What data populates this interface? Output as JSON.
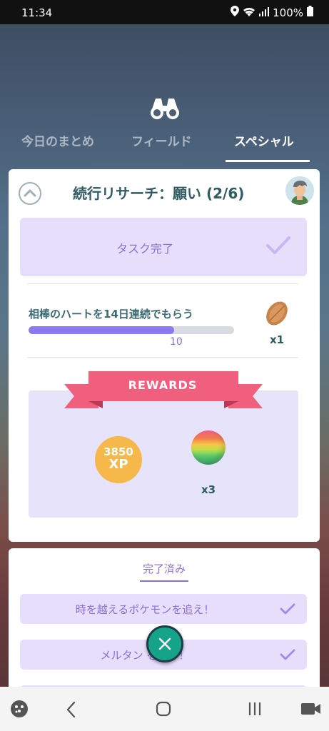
{
  "status_bar": {
    "time": "11:34",
    "battery": "100%"
  },
  "tabs": [
    {
      "label": "今日のまとめ",
      "active": false
    },
    {
      "label": "フィールド",
      "active": false
    },
    {
      "label": "スペシャル",
      "active": true
    }
  ],
  "research": {
    "title": "続行リサーチ：願い (2/6)",
    "task_done_label": "タスク完了",
    "task": {
      "text": "相棒のハートを14日連続でもらう",
      "progress_value": "10",
      "progress_fraction": 0.71,
      "reward_qty": "x1"
    },
    "rewards": {
      "banner": "REWARDS",
      "xp_amount": "3850",
      "xp_unit": "XP",
      "item_qty": "x3"
    }
  },
  "completed": {
    "title": "完了済み",
    "items": [
      {
        "label": "時を越えるポケモンを追え！"
      },
      {
        "label": "メルタン          を解け！"
      }
    ]
  },
  "colors": {
    "accent": "#8a6fd6",
    "teal_text": "#2f5b63",
    "ribbon": "#f0607e",
    "fab": "#15a48a"
  }
}
